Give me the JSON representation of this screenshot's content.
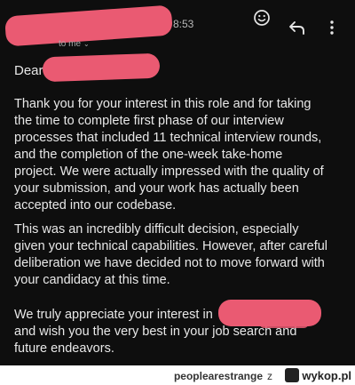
{
  "header": {
    "time_suffix": "8:53",
    "recipient_line": "to me",
    "recipient_chevron": "⌄"
  },
  "icons": {
    "emoji": "smiley-icon",
    "reply": "reply-icon",
    "more": "more-vertical-icon"
  },
  "body": {
    "greeting": "Dear",
    "paragraph_1": "Thank you for your interest in this role and for taking\nthe time to complete first phase of our interview\nprocesses that included 11 technical interview rounds,\nand the completion of the one-week take-home\nproject. We were actually impressed with the quality of\nyour submission, and your work has actually been\naccepted into our codebase.",
    "paragraph_2": "This was an incredibly difficult decision, especially\ngiven your technical capabilities. However, after careful\ndeliberation we have decided not to move forward with\nyour candidacy at this time.",
    "paragraph_3": "We truly appreciate your interest in\nand wish you the very best in your job search and\nfuture endeavors."
  },
  "footer": {
    "username": "peoplearestrange",
    "connector": "z",
    "site": "wykop.pl"
  },
  "colors": {
    "background": "#0e0e0e",
    "text": "#e8e8e8",
    "redaction": "#ea5a72"
  }
}
